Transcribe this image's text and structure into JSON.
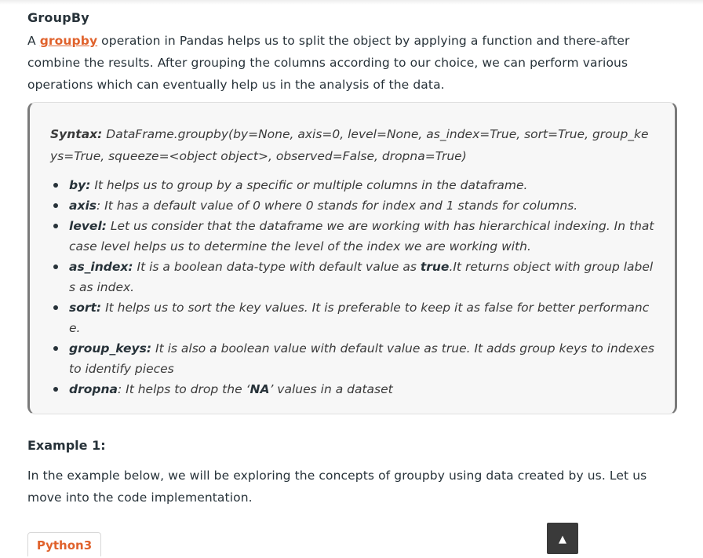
{
  "section": {
    "title": "GroupBy",
    "intro_before": "A ",
    "intro_link": "groupby",
    "intro_after": " operation in Pandas helps us to split the object by applying a function and there-after combine the results. After grouping the columns according to our choice, we can perform various operations which can eventually help us in the analysis of the data."
  },
  "syntax": {
    "label": "Syntax:",
    "signature": " DataFrame.groupby(by=None, axis=0, level=None, as_index=True, sort=True, group_keys=True, squeeze=<object object>, observed=False, dropna=True)"
  },
  "params": [
    {
      "name": "by:",
      "desc": " It helps us to group by a specific or multiple columns in the dataframe."
    },
    {
      "name": "axis",
      "desc": ": It has a default value of 0 where 0 stands for index and 1 stands for columns."
    },
    {
      "name": "level:",
      "desc": " Let us consider that the dataframe we are working with has hierarchical indexing. In that case level helps us to determine the level of the index we are working with."
    },
    {
      "name": "as_index:",
      "desc": " It is a boolean data-type with default value as ",
      "bold": "true",
      "desc2": ".It returns object with group labels as index."
    },
    {
      "name": "sort:",
      "desc": " It helps us to sort the key values. It is preferable to keep it as false for better performance."
    },
    {
      "name": "group_keys:",
      "desc": " It is also a boolean value with default value as true. It adds group keys to indexes to identify pieces"
    },
    {
      "name": "dropna",
      "desc": ": It helps to drop the ‘",
      "bold": "NA",
      "desc2": "’ values in a dataset"
    }
  ],
  "example": {
    "title": "Example 1:",
    "text": "In the example below, we will be exploring the concepts of groupby using data created by us. Let us move into the code implementation."
  },
  "code_tab": {
    "label": "Python3"
  },
  "scroll_top": {
    "glyph": "▲"
  }
}
